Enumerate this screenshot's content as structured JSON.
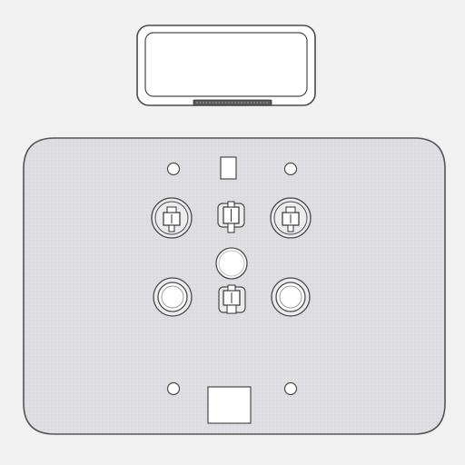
{
  "drawing": {
    "kind": "technical-line-drawing",
    "colors": {
      "background": "#f1f1f1",
      "plate_fill": "#dedee2",
      "stroke": "#4a4a4a",
      "part_fill": "#ffffff",
      "slot_fill": "#5a5a5a"
    },
    "components": {
      "cover_lid": {
        "icon": "rounded-rectangle-frame"
      },
      "upper_sockets": [
        {
          "name": "upper-left-socket"
        },
        {
          "name": "upper-center-connector"
        },
        {
          "name": "upper-right-socket"
        }
      ],
      "center_button": {
        "icon": "round-push-button"
      },
      "lower_sockets": [
        {
          "name": "lower-left-socket"
        },
        {
          "name": "lower-center-connector"
        },
        {
          "name": "lower-right-socket"
        }
      ],
      "mounting_holes": 4,
      "square_cutouts": 2
    }
  }
}
